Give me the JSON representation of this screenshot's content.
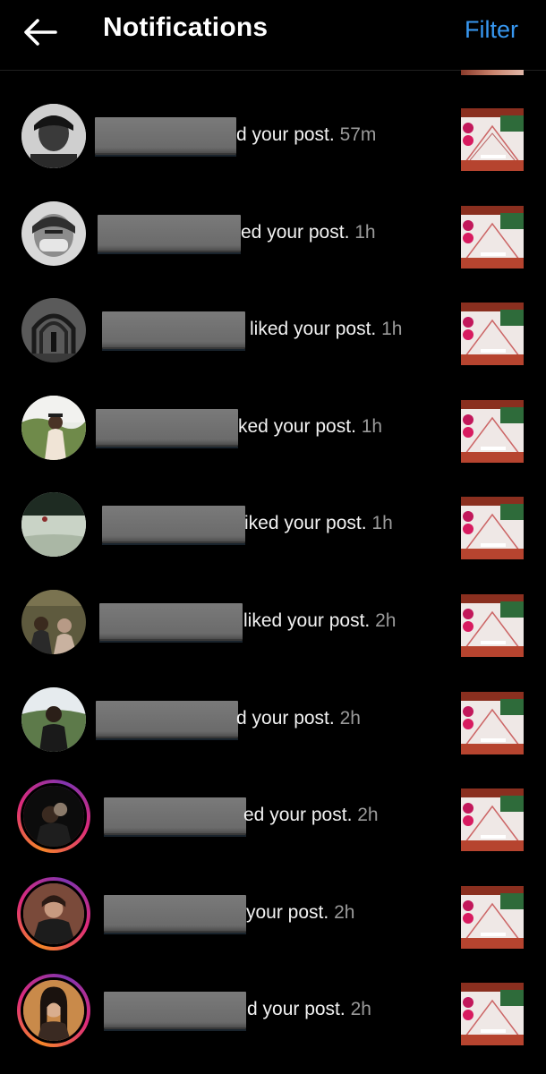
{
  "header": {
    "title": "Notifications",
    "filter_label": "Filter",
    "back_icon": "back-arrow-icon"
  },
  "colors": {
    "background": "#000000",
    "accent": "#3797f0",
    "meta_text": "#9a9a9a"
  },
  "notifications": [
    {
      "visible_text": "d your post.",
      "time": "57m",
      "story_ring": false
    },
    {
      "visible_text": "ed your post.",
      "time": "1h",
      "story_ring": false
    },
    {
      "visible_text": "liked your post.",
      "time": "1h",
      "story_ring": false
    },
    {
      "visible_text": "ked your post.",
      "time": "1h",
      "story_ring": false
    },
    {
      "visible_text": "iked your post.",
      "time": "1h",
      "story_ring": false
    },
    {
      "visible_text": "liked your post.",
      "time": "2h",
      "story_ring": false
    },
    {
      "visible_text": "d your post.",
      "time": "2h",
      "story_ring": false
    },
    {
      "visible_text": "ed your post.",
      "time": "2h",
      "story_ring": true
    },
    {
      "visible_text": "your post.",
      "time": "2h",
      "story_ring": true
    },
    {
      "visible_text": "d your post.",
      "time": "2h",
      "story_ring": true
    }
  ]
}
